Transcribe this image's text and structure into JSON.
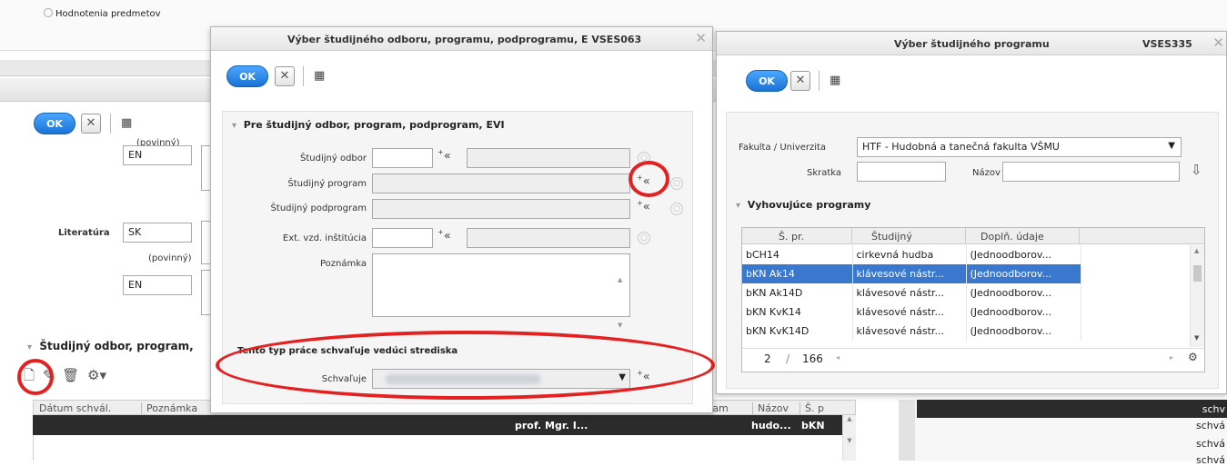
{
  "background": {
    "tab_label": "Hodnotenia predmetov",
    "toolbar": {
      "ok": "OK",
      "cancel": "✕",
      "grid_icon": "grid-icon"
    },
    "fields": {
      "povinny_top": "(povinný)",
      "lang_en_1": "EN",
      "literatura_label": "Literatúra",
      "lang_sk": "SK",
      "povinny": "(povinný)",
      "lang_en_2": "EN"
    },
    "section_title": "Študijný odbor, program,",
    "table": {
      "headers": [
        "Dátum schvál.",
        "Poznámka"
      ],
      "headers_right": [
        "tam",
        "Názov",
        "Š. p"
      ],
      "selected_row": {
        "person": "prof. Mgr. I...",
        "nazov": "hudo...",
        "sp": "bKN"
      },
      "right_cells": [
        "schv",
        "schvá",
        "schvá",
        "schvá"
      ]
    }
  },
  "dialog1": {
    "title": "Výber študijného odboru, programu, podprogramu, E VSES063",
    "ok": "OK",
    "section_title": "Pre študijný odbor, program, podprogram, EVI",
    "labels": {
      "odbor": "Študijný odbor",
      "program": "Študijný program",
      "podprogram": "Študijný podprogram",
      "ext": "Ext. vzd. inštitúcia",
      "poznamka": "Poznámka"
    },
    "approval_title": "Tento typ práce schvaľuje vedúci strediska",
    "approval_label": "Schvaľuje"
  },
  "dialog2": {
    "title": "Výber študijného programu",
    "code": "VSES335",
    "ok": "OK",
    "faculty_label": "Fakulta / Univerzita",
    "faculty_value": "HTF - Hudobná a tanečná fakulta VŠMU",
    "skratka_label": "Skratka",
    "nazov_label": "Názov",
    "matching_title": "Vyhovujúce programy",
    "columns": [
      "Š. pr.",
      "Študijný",
      "Doplň. údaje"
    ],
    "rows": [
      [
        "bCH14",
        "cirkevná hudba",
        "(Jednoodborov..."
      ],
      [
        "bKN Ak14",
        "klávesové nástr...",
        "(Jednoodborov..."
      ],
      [
        "bKN Ak14D",
        "klávesové nástr...",
        "(Jednoodborov..."
      ],
      [
        "bKN KvK14",
        "klávesové nástr...",
        "(Jednoodborov..."
      ],
      [
        "bKN KvK14D",
        "klávesové nástr...",
        "(Jednoodborov..."
      ]
    ],
    "selected_index": 1,
    "pager": {
      "page": "2",
      "sep": "/",
      "total": "166"
    }
  },
  "colors": {
    "selected_row": "#3a78cf",
    "annotation_red": "#e32121",
    "ok_blue": "#1a73d4"
  }
}
